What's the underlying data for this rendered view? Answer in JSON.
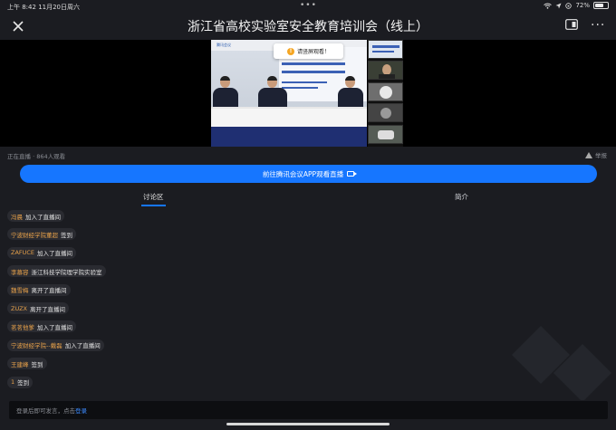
{
  "status_bar": {
    "time": "上午 8:42",
    "date": "11月20日周六",
    "dots": "•••",
    "battery": "72%",
    "battery_level": 0.72
  },
  "header": {
    "title": "浙江省高校实验室安全教育培训会（线上）",
    "more": "···"
  },
  "video": {
    "toast": "请竖屏观看！",
    "toast_icon": "warning-icon",
    "slide_logo": "腾讯会议"
  },
  "meta": {
    "live_text": "正在直播 · 864人观看",
    "report_label": "举报"
  },
  "app_button": {
    "label": "前往腾讯会议APP观看直播",
    "icon": "camera-icon",
    "color": "#1676ff"
  },
  "tabs": [
    {
      "label": "讨论区",
      "active": true
    },
    {
      "label": "简介",
      "active": false
    }
  ],
  "messages": [
    {
      "user": "冯晨",
      "action": "加入了直播间"
    },
    {
      "user": "宁波财经学院董超",
      "action": "签到"
    },
    {
      "user": "ZAFUCE",
      "action": "加入了直播间"
    },
    {
      "user": "李慕容",
      "action": "浙江科技学院理学院实验室"
    },
    {
      "user": "魏雪梅",
      "action": "离开了直播间"
    },
    {
      "user": "ZUZX",
      "action": "离开了直播间"
    },
    {
      "user": "茗茗他爹",
      "action": "加入了直播间"
    },
    {
      "user": "宁波财经学院--戴磊",
      "action": "加入了直播间"
    },
    {
      "user": "王建峰",
      "action": "签到"
    },
    {
      "user": "1",
      "action": "签到"
    }
  ],
  "input": {
    "placeholder": "登录后即可发言，点击",
    "login_link": "登录"
  },
  "colors": {
    "accent": "#1676ff",
    "username": "#e7a14a",
    "background": "#1b1c21"
  }
}
